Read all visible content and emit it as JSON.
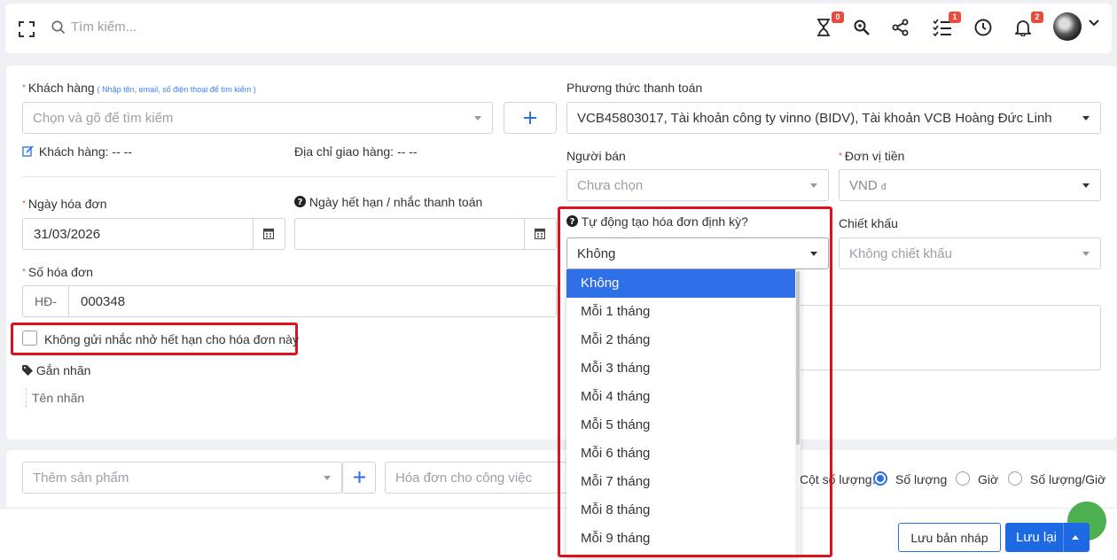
{
  "topbar": {
    "search_placeholder": "Tìm kiếm...",
    "badges": {
      "timer": "0",
      "tasks": "1",
      "notifications": "2"
    }
  },
  "form": {
    "customer": {
      "label": "Khách hàng",
      "hint": "( Nhập tên, email, số điện thoại để tìm kiếm )",
      "placeholder": "Chọn và gõ để tìm kiếm",
      "add": "+"
    },
    "customer_info_label": "Khách hàng:",
    "customer_info_value": "-- --",
    "shipping_label": "Địa chỉ giao hàng:",
    "shipping_value": "-- --",
    "invoice_date": {
      "label": "Ngày hóa đơn",
      "value": "31/03/2026"
    },
    "due_date": {
      "label": "Ngày hết hạn / nhắc thanh toán",
      "value": ""
    },
    "invoice_number": {
      "label": "Số hóa đơn",
      "prefix": "HĐ-",
      "value": "000348"
    },
    "no_reminder_label": "Không gửi nhắc nhở hết hạn cho hóa đơn này",
    "tags": {
      "label": "Gắn nhãn",
      "placeholder": "Tên nhãn"
    },
    "payment_method": {
      "label": "Phương thức thanh toán",
      "value": "VCB45803017, Tài khoản công ty vinno (BIDV), Tài khoản VCB Hoàng Đức Linh"
    },
    "seller": {
      "label": "Người bán",
      "placeholder": "Chưa chọn"
    },
    "currency": {
      "label": "Đơn vị tiền",
      "value": "VND",
      "symbol": "đ"
    },
    "recurring": {
      "label": "Tự động tạo hóa đơn định kỳ?",
      "value": "Không",
      "options": [
        "Không",
        "Mỗi 1 tháng",
        "Mỗi 2 tháng",
        "Mỗi 3 tháng",
        "Mỗi 4 tháng",
        "Mỗi 5 tháng",
        "Mỗi 6 tháng",
        "Mỗi 7 tháng",
        "Mỗi 8 tháng",
        "Mỗi 9 tháng"
      ]
    },
    "discount": {
      "label": "Chiết khấu",
      "placeholder": "Không chiết khấu"
    }
  },
  "products": {
    "add_placeholder": "Thêm sản phẩm",
    "add_button": "+",
    "task_placeholder": "Hóa đơn cho công việc",
    "qty_column_label": "Cột số lượng:",
    "qty_options": [
      "Số lượng",
      "Giờ",
      "Số lượng/Giờ"
    ]
  },
  "footer": {
    "draft_button": "Lưu bản nháp",
    "save_button": "Lưu lại"
  },
  "colors": {
    "primary": "#1d68e3",
    "highlight": "#e0101c",
    "badge": "#e74c3c"
  }
}
